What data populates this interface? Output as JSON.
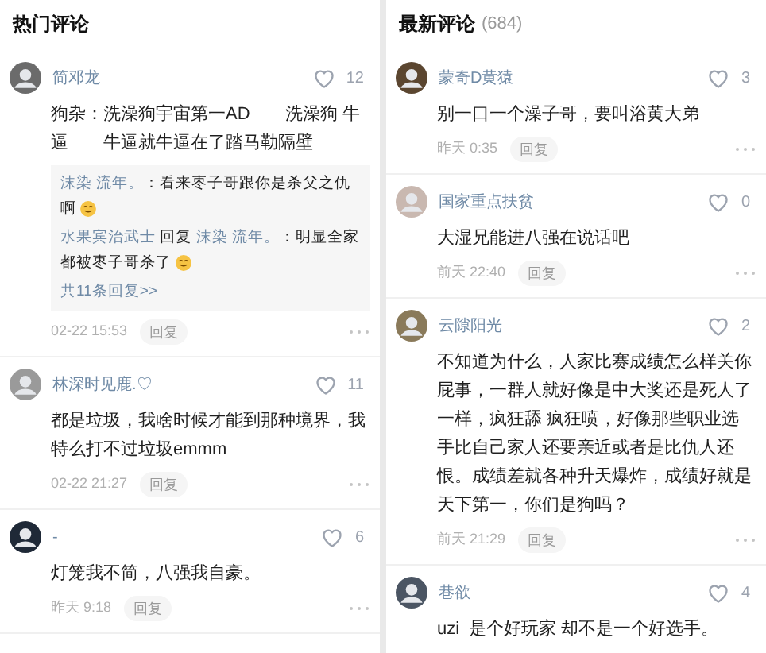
{
  "panels": [
    {
      "title": "热门评论",
      "comments": [
        {
          "author": "简邓龙",
          "likes": "12",
          "text": "狗杂：洗澡狗宇宙第一AD　　洗澡狗 牛逼　　牛逼就牛逼在了踏马勒隔壁",
          "replies": [
            {
              "author": "沫染 流年。",
              "text": "：看来枣子哥跟你是杀父之仇啊",
              "emoji": true
            },
            {
              "author": "水果宾治武士",
              "reply_label": "回复",
              "target": "沫染 流年。",
              "text": "：明显全家都被枣子哥杀了",
              "emoji": true
            }
          ],
          "more_replies": "共11条回复>>",
          "time": "02-22 15:53",
          "reply_button": "回复"
        },
        {
          "author": "林深时见鹿.♡",
          "likes": "11",
          "text": "都是垃圾，我啥时候才能到那种境界，我特么打不过垃圾emmm",
          "time": "02-22 21:27",
          "reply_button": "回复"
        },
        {
          "author": "-",
          "likes": "6",
          "text": "灯笼我不简，八强我自豪。",
          "time": "昨天 9:18",
          "reply_button": "回复"
        }
      ]
    },
    {
      "title": "最新评论",
      "count": "(684)",
      "comments": [
        {
          "author": "蒙奇D黄猿",
          "likes": "3",
          "text": "别一口一个澡子哥，要叫浴黄大弟",
          "time": "昨天 0:35",
          "reply_button": "回复"
        },
        {
          "author": "国家重点扶贫",
          "likes": "0",
          "text": "大湿兄能进八强在说话吧",
          "time": "前天 22:40",
          "reply_button": "回复"
        },
        {
          "author": "云隙阳光",
          "likes": "2",
          "text": "不知道为什么，人家比赛成绩怎么样关你屁事，一群人就好像是中大奖还是死人了一样，疯狂舔 疯狂喷，好像那些职业选手比自己家人还要亲近或者是比仇人还恨。成绩差就各种升天爆炸，成绩好就是天下第一，你们是狗吗？",
          "time": "前天 21:29",
          "reply_button": "回复"
        },
        {
          "author": "巷欲",
          "likes": "4",
          "text": "uzi  是个好玩家 却不是一个好选手。"
        }
      ]
    }
  ]
}
